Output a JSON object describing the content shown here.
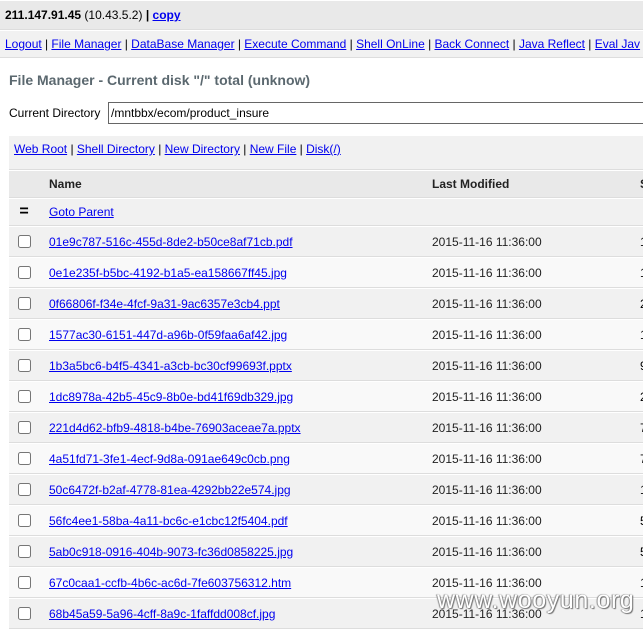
{
  "header": {
    "host_ip": "211.147.91.45",
    "local_ip": "(10.43.5.2)",
    "separator": "|",
    "copy_label": "copy"
  },
  "nav": {
    "separator": "|",
    "items": [
      {
        "label": "Logout"
      },
      {
        "label": "File Manager"
      },
      {
        "label": "DataBase Manager"
      },
      {
        "label": "Execute Command"
      },
      {
        "label": "Shell OnLine"
      },
      {
        "label": "Back Connect"
      },
      {
        "label": "Java Reflect"
      },
      {
        "label": "Eval Jav"
      }
    ]
  },
  "page_title": "File Manager - Current disk \"/\" total (unknow)",
  "current_directory": {
    "label": "Current Directory",
    "value": "/mntbbx/ecom/product_insure"
  },
  "toolbar": {
    "separator": "|",
    "links": [
      {
        "label": "Web Root"
      },
      {
        "label": "Shell Directory"
      },
      {
        "label": "New Directory"
      },
      {
        "label": "New File"
      },
      {
        "label": "Disk(/)"
      }
    ]
  },
  "file_table": {
    "columns": {
      "name": "Name",
      "last_modified": "Last Modified",
      "size": "S"
    },
    "parent_row": {
      "icon": "=",
      "icon_name": "parent-directory-icon",
      "label": "Goto Parent"
    },
    "rows": [
      {
        "name": "01e9c787-516c-455d-8de2-b50ce8af71cb.pdf",
        "modified": "2015-11-16 11:36:00",
        "size": "1"
      },
      {
        "name": "0e1e235f-b5bc-4192-b1a5-ea158667ff45.jpg",
        "modified": "2015-11-16 11:36:00",
        "size": "1"
      },
      {
        "name": "0f66806f-f34e-4fcf-9a31-9ac6357e3cb4.ppt",
        "modified": "2015-11-16 11:36:00",
        "size": "2"
      },
      {
        "name": "1577ac30-6151-447d-a96b-0f59faa6af42.jpg",
        "modified": "2015-11-16 11:36:00",
        "size": "1"
      },
      {
        "name": "1b3a5bc6-b4f5-4341-a3cb-bc30cf99693f.pptx",
        "modified": "2015-11-16 11:36:00",
        "size": "9"
      },
      {
        "name": "1dc8978a-42b5-45c9-8b0e-bd41f69db329.jpg",
        "modified": "2015-11-16 11:36:00",
        "size": "2"
      },
      {
        "name": "221d4d62-bfb9-4818-b4be-76903aceae7a.pptx",
        "modified": "2015-11-16 11:36:00",
        "size": "7"
      },
      {
        "name": "4a51fd71-3fe1-4ecf-9d8a-091ae649c0cb.png",
        "modified": "2015-11-16 11:36:00",
        "size": "7"
      },
      {
        "name": "50c6472f-b2af-4778-81ea-4292bb22e574.jpg",
        "modified": "2015-11-16 11:36:00",
        "size": "1"
      },
      {
        "name": "56fc4ee1-58ba-4a11-bc6c-e1cbc12f5404.pdf",
        "modified": "2015-11-16 11:36:00",
        "size": "5"
      },
      {
        "name": "5ab0c918-0916-404b-9073-fc36d0858225.jpg",
        "modified": "2015-11-16 11:36:00",
        "size": "5"
      },
      {
        "name": "67c0caa1-ccfb-4b6c-ac6d-7fe603756312.htm",
        "modified": "2015-11-16 11:36:00",
        "size": "1"
      },
      {
        "name": "68b45a59-5a96-4cff-8a9c-1faffdd008cf.jpg",
        "modified": "2015-11-16 11:36:00",
        "size": "1"
      }
    ]
  },
  "watermark": "www.wooyun.org",
  "colors": {
    "link": "#0000ee",
    "header_bg": "#e9e9e9",
    "alt1_bg": "#f1f1f1",
    "alt2_bg": "#f9f9f9",
    "title": "#5b686f"
  }
}
